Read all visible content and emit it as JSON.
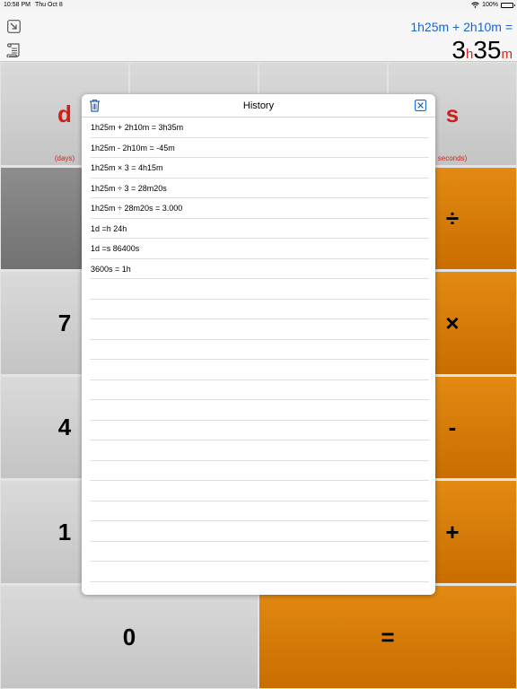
{
  "status": {
    "time": "10:58 PM",
    "date": "Thu Oct 8",
    "battery": "100%",
    "battery_level": 1.0
  },
  "display": {
    "expression": "1h25m + 2h10m =",
    "result": [
      {
        "text": "3",
        "unit": false
      },
      {
        "text": "h",
        "unit": true
      },
      {
        "text": "35",
        "unit": false
      },
      {
        "text": "m",
        "unit": true
      }
    ]
  },
  "keys": {
    "days": {
      "label": "d",
      "sub": "(days)"
    },
    "seconds": {
      "label": "s",
      "sub": "seconds)"
    },
    "divide": "÷",
    "seven": "7",
    "multiply": "×",
    "four": "4",
    "minus": "-",
    "one": "1",
    "plus": "+",
    "zero": "0",
    "equals": "="
  },
  "history": {
    "title": "History",
    "items": [
      "1h25m + 2h10m = 3h35m",
      "1h25m - 2h10m = -45m",
      "1h25m × 3 = 4h15m",
      "1h25m ÷ 3 = 28m20s",
      "1h25m ÷ 28m20s = 3.000",
      "1d =h 24h",
      "1d =s 86400s",
      "3600s = 1h",
      "",
      "",
      "",
      "",
      "",
      "",
      "",
      "",
      "",
      "",
      "",
      "",
      "",
      "",
      ""
    ]
  },
  "colors": {
    "accent_blue": "#1a64d0",
    "unit_red": "#d8201c",
    "operator_orange": "#d97a08",
    "key_gray": "#cfcfcf"
  },
  "icons": [
    "wifi-icon",
    "battery-icon",
    "collapse-icon",
    "tape-icon",
    "trash-icon",
    "close-icon"
  ]
}
